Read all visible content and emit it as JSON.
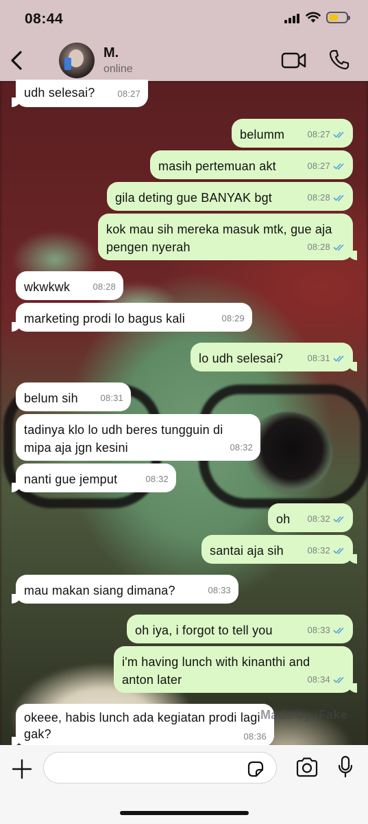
{
  "status_bar": {
    "time": "08:44"
  },
  "header": {
    "contact_name": "M.",
    "contact_status": "online"
  },
  "messages": [
    {
      "dir": "in",
      "text": "udh selesai?",
      "time": "08:27"
    },
    {
      "dir": "out",
      "text": "belumm",
      "time": "08:27",
      "read": true
    },
    {
      "dir": "out",
      "text": "masih pertemuan akt",
      "time": "08:27",
      "read": true
    },
    {
      "dir": "out",
      "text": "gila deting gue BANYAK bgt",
      "time": "08:28",
      "read": true
    },
    {
      "dir": "out",
      "text": "kok mau sih mereka masuk mtk, gue aja pengen nyerah",
      "time": "08:28",
      "read": true
    },
    {
      "dir": "in",
      "text": "wkwkwk",
      "time": "08:28"
    },
    {
      "dir": "in",
      "text": "marketing prodi lo bagus kali",
      "time": "08:29"
    },
    {
      "dir": "out",
      "text": "lo udh selesai?",
      "time": "08:31",
      "read": true
    },
    {
      "dir": "in",
      "text": "belum sih",
      "time": "08:31"
    },
    {
      "dir": "in",
      "text": "tadinya klo lo udh beres tungguin di mipa aja jgn kesini",
      "time": "08:32"
    },
    {
      "dir": "in",
      "text": "nanti gue jemput",
      "time": "08:32"
    },
    {
      "dir": "out",
      "text": "oh",
      "time": "08:32",
      "read": true
    },
    {
      "dir": "out",
      "text": "santai aja sih",
      "time": "08:32",
      "read": true
    },
    {
      "dir": "in",
      "text": "mau makan siang dimana?",
      "time": "08:33"
    },
    {
      "dir": "out",
      "text": "oh iya, i forgot to tell you",
      "time": "08:33",
      "read": true
    },
    {
      "dir": "out",
      "text": "i'm having lunch with kinanthi and anton later",
      "time": "08:34",
      "read": true
    },
    {
      "dir": "in",
      "text": "okeee, habis lunch ada kegiatan prodi lagi gak?",
      "time": "08:36"
    }
  ],
  "watermark": "Made by iFake",
  "composer": {
    "placeholder": "",
    "value": ""
  },
  "colors": {
    "incoming": "#ffffff",
    "outgoing": "#dcf8c6",
    "tick_read": "#4fa3e0"
  },
  "icons": {
    "back": "chevron-left-icon",
    "video": "video-camera-icon",
    "call": "phone-icon",
    "plus": "plus-icon",
    "sticker": "sticker-icon",
    "camera": "camera-icon",
    "mic": "microphone-icon"
  }
}
